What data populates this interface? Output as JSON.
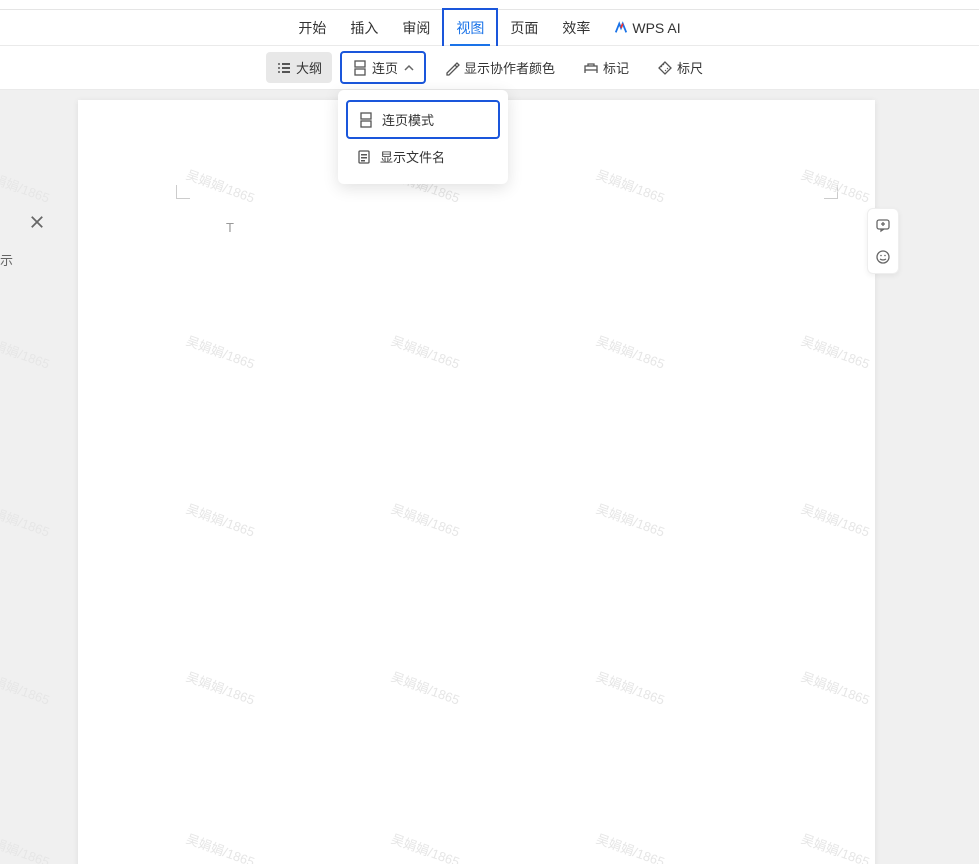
{
  "menu": {
    "items": [
      {
        "label": "开始"
      },
      {
        "label": "插入"
      },
      {
        "label": "审阅"
      },
      {
        "label": "视图",
        "active": true,
        "highlight": true
      },
      {
        "label": "页面"
      },
      {
        "label": "效率"
      }
    ],
    "wps_ai": "WPS AI"
  },
  "toolbar": {
    "outline": "大纲",
    "continuous": "连页",
    "show_author_color": "显示协作者颜色",
    "mark": "标记",
    "ruler": "标尺"
  },
  "dropdown": {
    "continuous_mode": "连页模式",
    "show_filename": "显示文件名"
  },
  "side": {
    "label": "示"
  },
  "cursor": "T",
  "watermark": "吴娟娟/1865",
  "icons": {
    "outline": "outline-icon",
    "continuous": "page-split-icon",
    "author_color": "pencil-icon",
    "mark": "flag-icon",
    "ruler": "ruler-icon",
    "comment": "comment-plus-icon",
    "emoji": "emoji-icon",
    "close": "close-icon",
    "filename": "file-icon",
    "chevron": "chevron-up-icon"
  }
}
